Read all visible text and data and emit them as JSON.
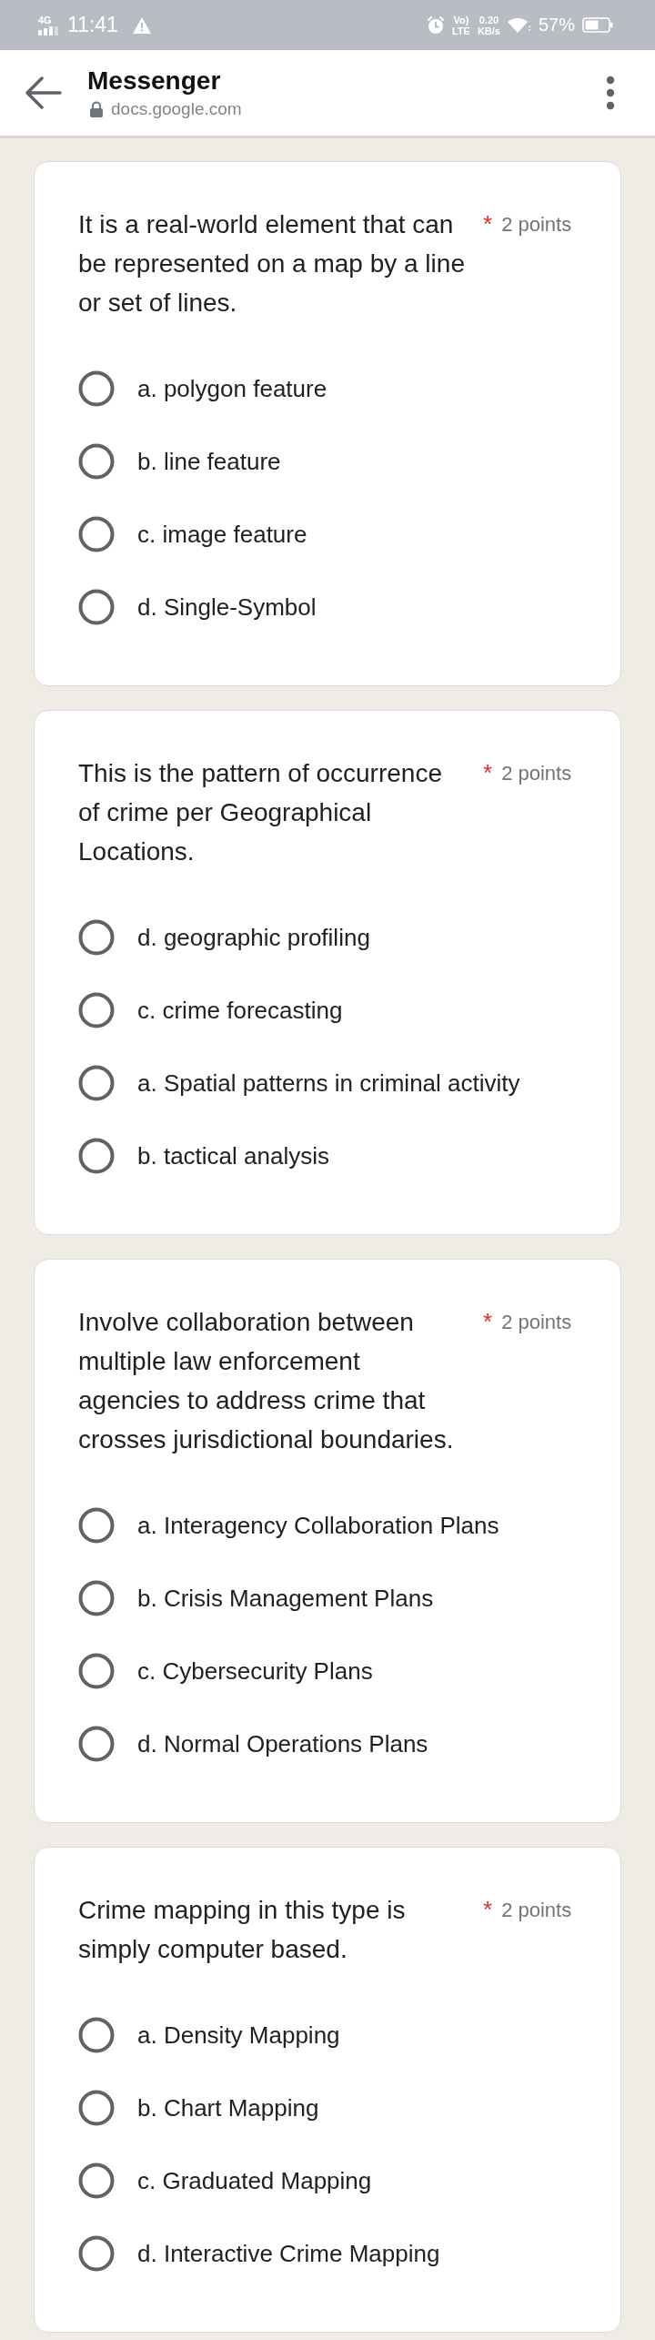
{
  "status_bar": {
    "network": "4G",
    "time": "11:41",
    "volte_top": "Vo)",
    "volte_bottom": "LTE",
    "speed": "0.20",
    "speed_unit": "KB/s",
    "battery": "57%"
  },
  "header": {
    "title": "Messenger",
    "url": "docs.google.com"
  },
  "questions": [
    {
      "text": "It is a real-world element that can be represented on a map by a line or set of lines.",
      "required_mark": "*",
      "points": "2 points",
      "options": [
        {
          "label": "a. polygon feature",
          "selected": false
        },
        {
          "label": "b. line feature",
          "selected": false
        },
        {
          "label": "c. image feature",
          "selected": false
        },
        {
          "label": "d. Single-Symbol",
          "selected": false
        }
      ]
    },
    {
      "text": "This is the pattern of occurrence of crime per Geographical Locations.",
      "required_mark": "*",
      "points": "2 points",
      "options": [
        {
          "label": "d. geographic profiling",
          "selected": false
        },
        {
          "label": "c. crime forecasting",
          "selected": false
        },
        {
          "label": "a. Spatial patterns in criminal activity",
          "selected": false
        },
        {
          "label": "b. tactical analysis",
          "selected": false
        }
      ]
    },
    {
      "text": "Involve collaboration between multiple law enforcement agencies to address crime that crosses jurisdictional boundaries.",
      "required_mark": "*",
      "points": "2 points",
      "options": [
        {
          "label": "a. Interagency Collaboration Plans",
          "selected": false
        },
        {
          "label": "b. Crisis Management Plans",
          "selected": false
        },
        {
          "label": "c. Cybersecurity Plans",
          "selected": false
        },
        {
          "label": "d. Normal Operations Plans",
          "selected": false
        }
      ]
    },
    {
      "text": "Crime mapping in this type is simply computer based.",
      "required_mark": "*",
      "points": "2 points",
      "options": [
        {
          "label": "a. Density Mapping",
          "selected": false
        },
        {
          "label": "b. Chart Mapping",
          "selected": false
        },
        {
          "label": "c. Graduated Mapping",
          "selected": false
        },
        {
          "label": "d. Interactive Crime Mapping",
          "selected": false
        }
      ]
    }
  ]
}
